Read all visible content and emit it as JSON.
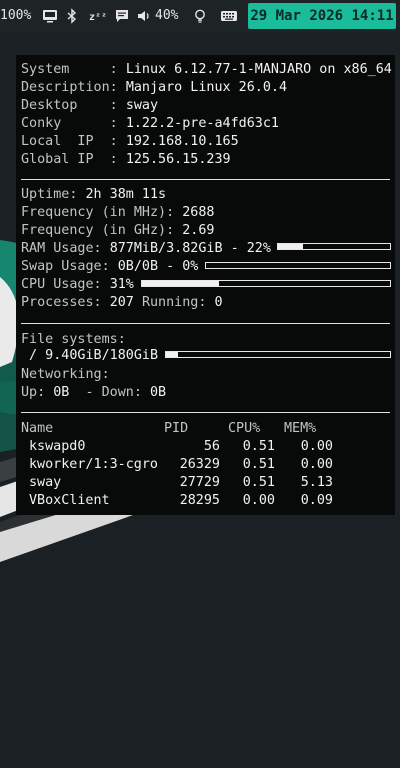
{
  "topbar": {
    "battery": "100%",
    "volume": "40%",
    "clock": "29 Mar 2026 14:11",
    "icons": [
      "monitor-icon",
      "bluetooth-icon",
      "sleep-icon",
      "notification-icon",
      "volume-icon",
      "lightbulb-icon",
      "keyboard-icon"
    ],
    "accent": "#1abc9c"
  },
  "conky": {
    "system": [
      {
        "label": "System     : ",
        "value": "Linux 6.12.77-1-MANJARO on x86_64"
      },
      {
        "label": "Description: ",
        "value": "Manjaro Linux 26.0.4"
      },
      {
        "label": "Desktop    : ",
        "value": "sway"
      },
      {
        "label": "Conky      : ",
        "value": "1.22.2-pre-a4fd63c1"
      },
      {
        "label": "Local  IP  : ",
        "value": "192.168.10.165"
      },
      {
        "label": "Global IP  : ",
        "value": "125.56.15.239"
      }
    ],
    "uptime": {
      "label": "Uptime: ",
      "value": "2h 38m 11s"
    },
    "freq_mhz": {
      "label": "Frequency (in MHz): ",
      "value": "2688"
    },
    "freq_ghz": {
      "label": "Frequency (in GHz): ",
      "value": "2.69"
    },
    "ram": {
      "label": "RAM Usage: ",
      "value": "877MiB/3.82GiB - 22%",
      "fraction": 0.22
    },
    "swap": {
      "label": "Swap Usage: ",
      "value": "0B/0B - 0%",
      "fraction": 0.0
    },
    "cpu": {
      "label": "CPU Usage: ",
      "value": "31%",
      "fraction": 0.31
    },
    "processes": {
      "label": "Processes: ",
      "value": "207",
      "running_label": "Running: ",
      "running_value": "0"
    },
    "filesystems": {
      "label": "File systems:",
      "value": " / 9.40GiB/180GiB",
      "fraction": 0.052
    },
    "networking": {
      "label": "Networking:",
      "up_label": "Up: ",
      "up_value": "0B",
      "down_label": "  - Down: ",
      "down_value": "0B"
    },
    "table": {
      "headers": [
        "Name",
        "PID",
        "CPU%",
        "MEM%"
      ],
      "rows": [
        [
          "kswapd0",
          "56",
          "0.51",
          "0.00"
        ],
        [
          "kworker/1:3-cgro",
          "26329",
          "0.51",
          "0.00"
        ],
        [
          "sway",
          "27729",
          "0.51",
          "5.13"
        ],
        [
          "VBoxClient",
          "28295",
          "0.00",
          "0.09"
        ]
      ]
    }
  }
}
